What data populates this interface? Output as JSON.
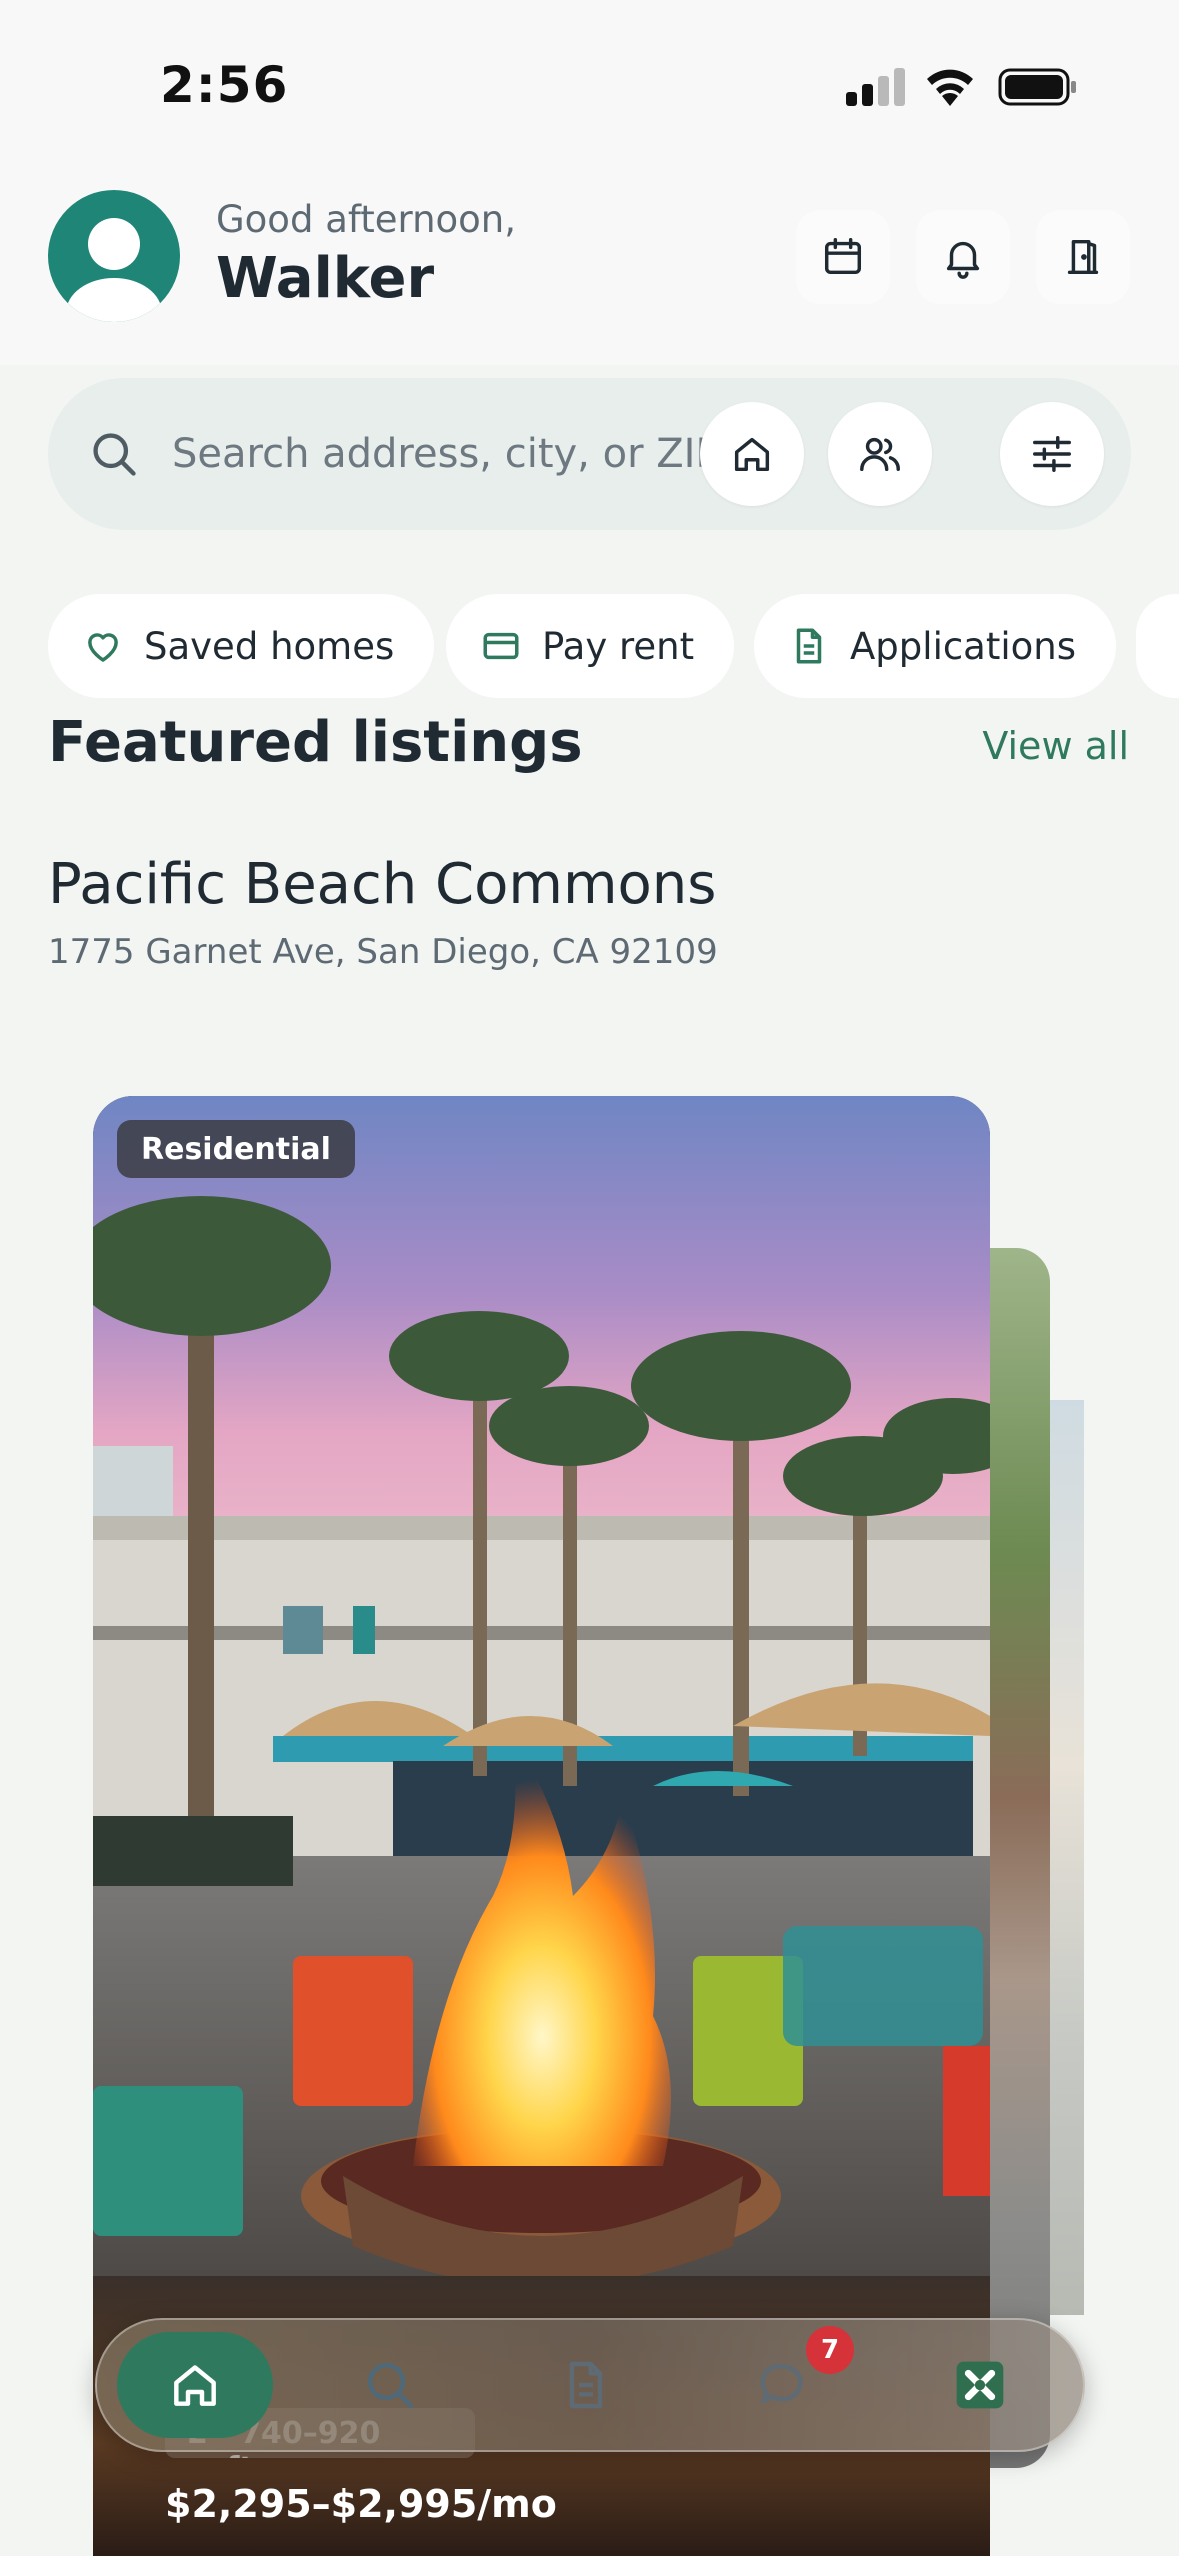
{
  "status_bar": {
    "time": "2:56"
  },
  "header": {
    "greeting": "Good afternoon,",
    "user_name": "Walker",
    "buttons": [
      "calendar-icon",
      "bell-icon",
      "door-icon"
    ]
  },
  "search": {
    "placeholder": "Search address, city, or ZIP",
    "value": "",
    "buttons": [
      "home-icon",
      "people-icon",
      "sliders-icon"
    ]
  },
  "chips": [
    {
      "label": "Saved homes",
      "icon": "heart-icon"
    },
    {
      "label": "Pay rent",
      "icon": "card-icon"
    },
    {
      "label": "Applications",
      "icon": "document-icon"
    }
  ],
  "featured": {
    "title": "Featured listings",
    "view_all": "View all",
    "property": {
      "name": "Pacific Beach Commons",
      "address": "1775 Garnet Ave, San Diego, CA 92109",
      "badge": "Residential",
      "size": "2 · 740–920 sqft",
      "price": "$2,295–$2,995/mo"
    }
  },
  "tab_bar": {
    "tabs": [
      "home-icon",
      "search-icon",
      "document-icon",
      "chat-icon",
      "app-logo-icon"
    ],
    "active": "home",
    "messages_badge": "7"
  },
  "colors": {
    "accent": "#2f7a5e",
    "avatar": "#1f8577",
    "badge_red": "#d6323a",
    "background": "#f3f5f3"
  }
}
